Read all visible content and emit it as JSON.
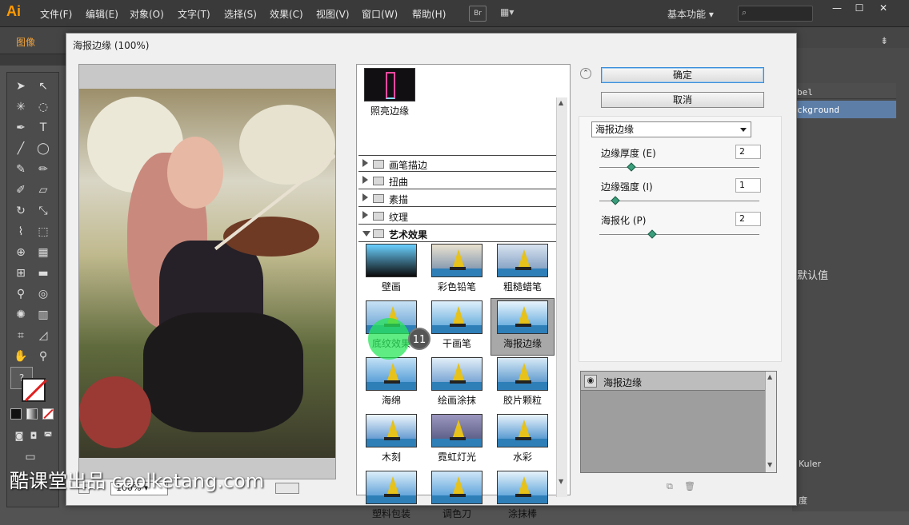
{
  "app": {
    "logo": "Ai",
    "menus": [
      "文件(F)",
      "编辑(E)",
      "对象(O)",
      "文字(T)",
      "选择(S)",
      "效果(C)",
      "视图(V)",
      "窗口(W)",
      "帮助(H)"
    ],
    "bridge_label": "Br",
    "workspace": "基本功能",
    "object_label": "图像"
  },
  "right_panel": {
    "layer1": "bel",
    "layer2": "ckground",
    "defaults_label": "默认值",
    "kuler_label": "Kuler",
    "bottom_label": "度"
  },
  "dialog": {
    "title": "海报边缘 (100%)",
    "zoom_value": "100%",
    "categories": [
      {
        "label": "画笔描边"
      },
      {
        "label": "扭曲"
      },
      {
        "label": "素描"
      },
      {
        "label": "纹理"
      },
      {
        "label": "艺术效果"
      }
    ],
    "prev_thumb_label": "照亮边缘",
    "thumbnails": [
      {
        "label": "壁画"
      },
      {
        "label": "彩色铅笔"
      },
      {
        "label": "粗糙蜡笔"
      },
      {
        "label": "底纹效果"
      },
      {
        "label": "干画笔"
      },
      {
        "label": "海报边缘"
      },
      {
        "label": "海绵"
      },
      {
        "label": "绘画涂抹"
      },
      {
        "label": "胶片颗粒"
      },
      {
        "label": "木刻"
      },
      {
        "label": "霓虹灯光"
      },
      {
        "label": "水彩"
      },
      {
        "label": "塑料包装"
      },
      {
        "label": "调色刀"
      },
      {
        "label": "涂抹棒"
      }
    ],
    "ok_label": "确定",
    "cancel_label": "取消",
    "selected_filter": "海报边缘",
    "params": [
      {
        "label": "边缘厚度 (E)",
        "value": "2",
        "level": 0.2
      },
      {
        "label": "边缘强度 (I)",
        "value": "1",
        "level": 0.1
      },
      {
        "label": "海报化 (P)",
        "value": "2",
        "level": 0.33
      }
    ],
    "effect_layer": "海报边缘"
  },
  "overlay": {
    "step_badge": "11",
    "watermark": "酷课堂出品 coolketang.com"
  }
}
